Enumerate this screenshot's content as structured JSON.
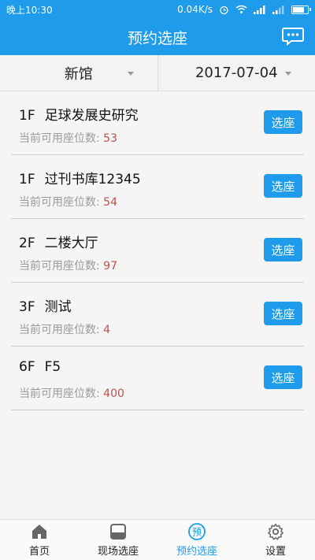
{
  "status": {
    "time": "晚上10:30",
    "speed": "0.04K/s"
  },
  "header": {
    "title": "预约选座",
    "message_icon": "chat-bubble-icon"
  },
  "filters": {
    "library": "新馆",
    "date": "2017-07-04"
  },
  "rooms": [
    {
      "floor": "1F",
      "name": "足球发展史研究",
      "avail_label": "当前可用座位数:",
      "count": "53",
      "button": "选座"
    },
    {
      "floor": "1F",
      "name": "过刊书库12345",
      "avail_label": "当前可用座位数:",
      "count": "54",
      "button": "选座"
    },
    {
      "floor": "2F",
      "name": "二楼大厅",
      "avail_label": "当前可用座位数:",
      "count": "97",
      "button": "选座"
    },
    {
      "floor": "3F",
      "name": "测试",
      "avail_label": "当前可用座位数:",
      "count": "4",
      "button": "选座"
    },
    {
      "floor": "6F",
      "name": "F5",
      "avail_label": "当前可用座位数:",
      "count": "400",
      "button": "选座"
    }
  ],
  "tabs": [
    {
      "label": "首页",
      "icon": "home-icon",
      "active": false
    },
    {
      "label": "现场选座",
      "icon": "seat-icon",
      "active": false
    },
    {
      "label": "预约选座",
      "icon": "reserve-icon",
      "active": true
    },
    {
      "label": "设置",
      "icon": "gear-icon",
      "active": false
    }
  ],
  "colors": {
    "accent": "#1e9bea",
    "count": "#c0504d"
  }
}
